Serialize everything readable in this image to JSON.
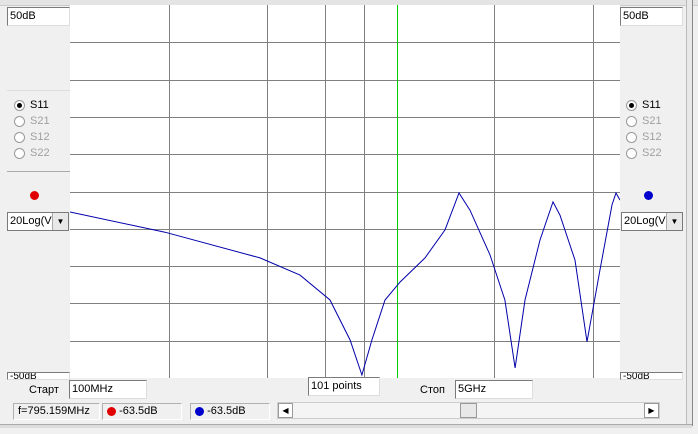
{
  "left_panel": {
    "scale_top": "50dB",
    "scale_bottom": "-50dB",
    "radios": [
      {
        "label": "S11",
        "checked": true,
        "enabled": true
      },
      {
        "label": "S21",
        "checked": false,
        "enabled": false
      },
      {
        "label": "S12",
        "checked": false,
        "enabled": false
      },
      {
        "label": "S22",
        "checked": false,
        "enabled": false
      }
    ],
    "marker_color": "#e00000",
    "format": "20Log(V)"
  },
  "right_panel": {
    "scale_top": "50dB",
    "scale_bottom": "-50dB",
    "radios": [
      {
        "label": "S11",
        "checked": true,
        "enabled": true
      },
      {
        "label": "S21",
        "checked": false,
        "enabled": false
      },
      {
        "label": "S12",
        "checked": false,
        "enabled": false
      },
      {
        "label": "S22",
        "checked": false,
        "enabled": false
      }
    ],
    "marker_color": "#0000cc",
    "format": "20Log(V)"
  },
  "sweep": {
    "start_label": "Старт",
    "start_value": "100MHz",
    "points": "101 points",
    "stop_label": "Стоп",
    "stop_value": "5GHz"
  },
  "status": {
    "frequency": "f=795.159MHz",
    "marker1": "-63.5dB",
    "marker2": "-63.5dB"
  },
  "colors": {
    "trace": "#0000aa",
    "marker_line": "#00cc00",
    "grid": "#808080"
  },
  "scrollbar": {
    "position": 0.5
  },
  "chart_data": {
    "type": "line",
    "x_unit": "MHz",
    "y_unit": "dB",
    "xlim": [
      100,
      5000
    ],
    "ylim": [
      -50,
      50
    ],
    "marker_freq": 3013,
    "series": [
      {
        "name": "S11",
        "points": [
          [
            100,
            -5.5
          ],
          [
            946,
            -10.9
          ],
          [
            1793,
            -17.8
          ],
          [
            2149,
            -22.4
          ],
          [
            2416,
            -29.1
          ],
          [
            2595,
            -39.8
          ],
          [
            2701,
            -49.2
          ],
          [
            2790,
            -39.8
          ],
          [
            2906,
            -29.1
          ],
          [
            3040,
            -24.3
          ],
          [
            3263,
            -17.8
          ],
          [
            3441,
            -10.3
          ],
          [
            3566,
            -0.4
          ],
          [
            3664,
            -5.0
          ],
          [
            3842,
            -17.0
          ],
          [
            3975,
            -29.1
          ],
          [
            4065,
            -47.3
          ],
          [
            4154,
            -29.1
          ],
          [
            4287,
            -13.0
          ],
          [
            4403,
            -2.8
          ],
          [
            4465,
            -6.3
          ],
          [
            4599,
            -18.4
          ],
          [
            4706,
            -40.3
          ],
          [
            4822,
            -21.0
          ],
          [
            4929,
            -3.6
          ],
          [
            4964,
            -0.4
          ],
          [
            5000,
            -2.3
          ]
        ]
      }
    ]
  }
}
